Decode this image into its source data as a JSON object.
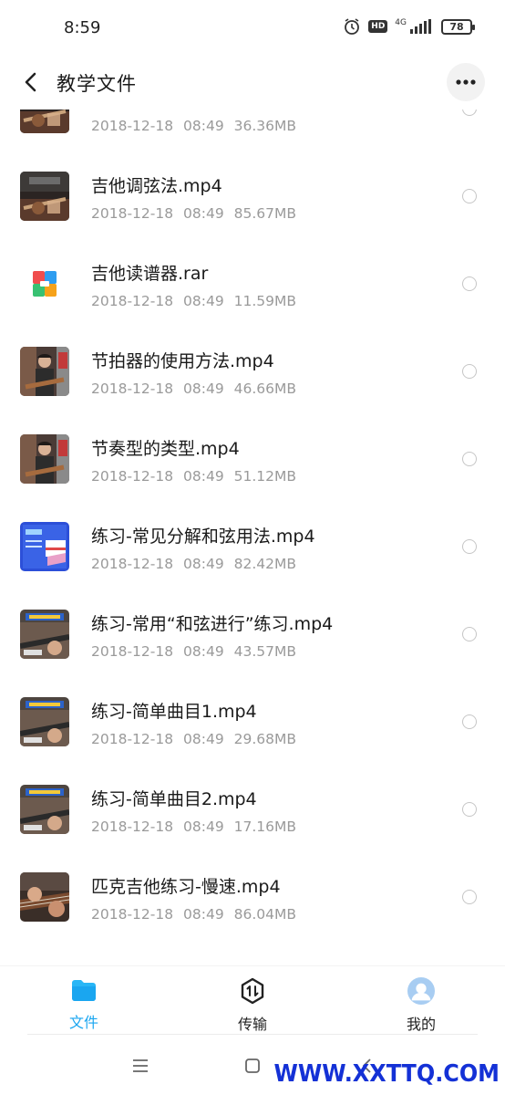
{
  "status_bar": {
    "time": "8:59",
    "network": "4G",
    "hd": "HD",
    "battery": "78"
  },
  "header": {
    "title": "教学文件",
    "back_icon": "chevron-left-icon",
    "more_icon": "more-dots-icon"
  },
  "files": [
    {
      "name": "",
      "date": "2018-12-18",
      "time": "08:49",
      "size": "36.36MB",
      "thumb": "video-guitar"
    },
    {
      "name": "吉他调弦法.mp4",
      "date": "2018-12-18",
      "time": "08:49",
      "size": "85.67MB",
      "thumb": "video-guitar"
    },
    {
      "name": "吉他读谱器.rar",
      "date": "2018-12-18",
      "time": "08:49",
      "size": "11.59MB",
      "thumb": "archive-icon"
    },
    {
      "name": "节拍器的使用方法.mp4",
      "date": "2018-12-18",
      "time": "08:49",
      "size": "46.66MB",
      "thumb": "video-person"
    },
    {
      "name": "节奏型的类型.mp4",
      "date": "2018-12-18",
      "time": "08:49",
      "size": "51.12MB",
      "thumb": "video-person"
    },
    {
      "name": "练习-常见分解和弦用法.mp4",
      "date": "2018-12-18",
      "time": "08:49",
      "size": "82.42MB",
      "thumb": "video-blue"
    },
    {
      "name": "练习-常用“和弦进行”练习.mp4",
      "date": "2018-12-18",
      "time": "08:49",
      "size": "43.57MB",
      "thumb": "video-lesson"
    },
    {
      "name": "练习-简单曲目1.mp4",
      "date": "2018-12-18",
      "time": "08:49",
      "size": "29.68MB",
      "thumb": "video-lesson"
    },
    {
      "name": "练习-简单曲目2.mp4",
      "date": "2018-12-18",
      "time": "08:49",
      "size": "17.16MB",
      "thumb": "video-lesson"
    },
    {
      "name": "匹克吉他练习-慢速.mp4",
      "date": "2018-12-18",
      "time": "08:49",
      "size": "86.04MB",
      "thumb": "video-hands"
    }
  ],
  "bottom_nav": {
    "tabs": [
      {
        "label": "文件",
        "icon": "folder-icon",
        "active": true
      },
      {
        "label": "传输",
        "icon": "transfer-icon",
        "active": false
      },
      {
        "label": "我的",
        "icon": "avatar-icon",
        "active": false
      }
    ]
  },
  "system_nav": {
    "menu": "menu-icon",
    "home": "home-icon",
    "back": "back-icon"
  },
  "watermark": "WWW.XXTTQ.COM",
  "colors": {
    "accent": "#1aa6f0",
    "meta": "#9a9a9a",
    "watermark": "#1431d6"
  }
}
